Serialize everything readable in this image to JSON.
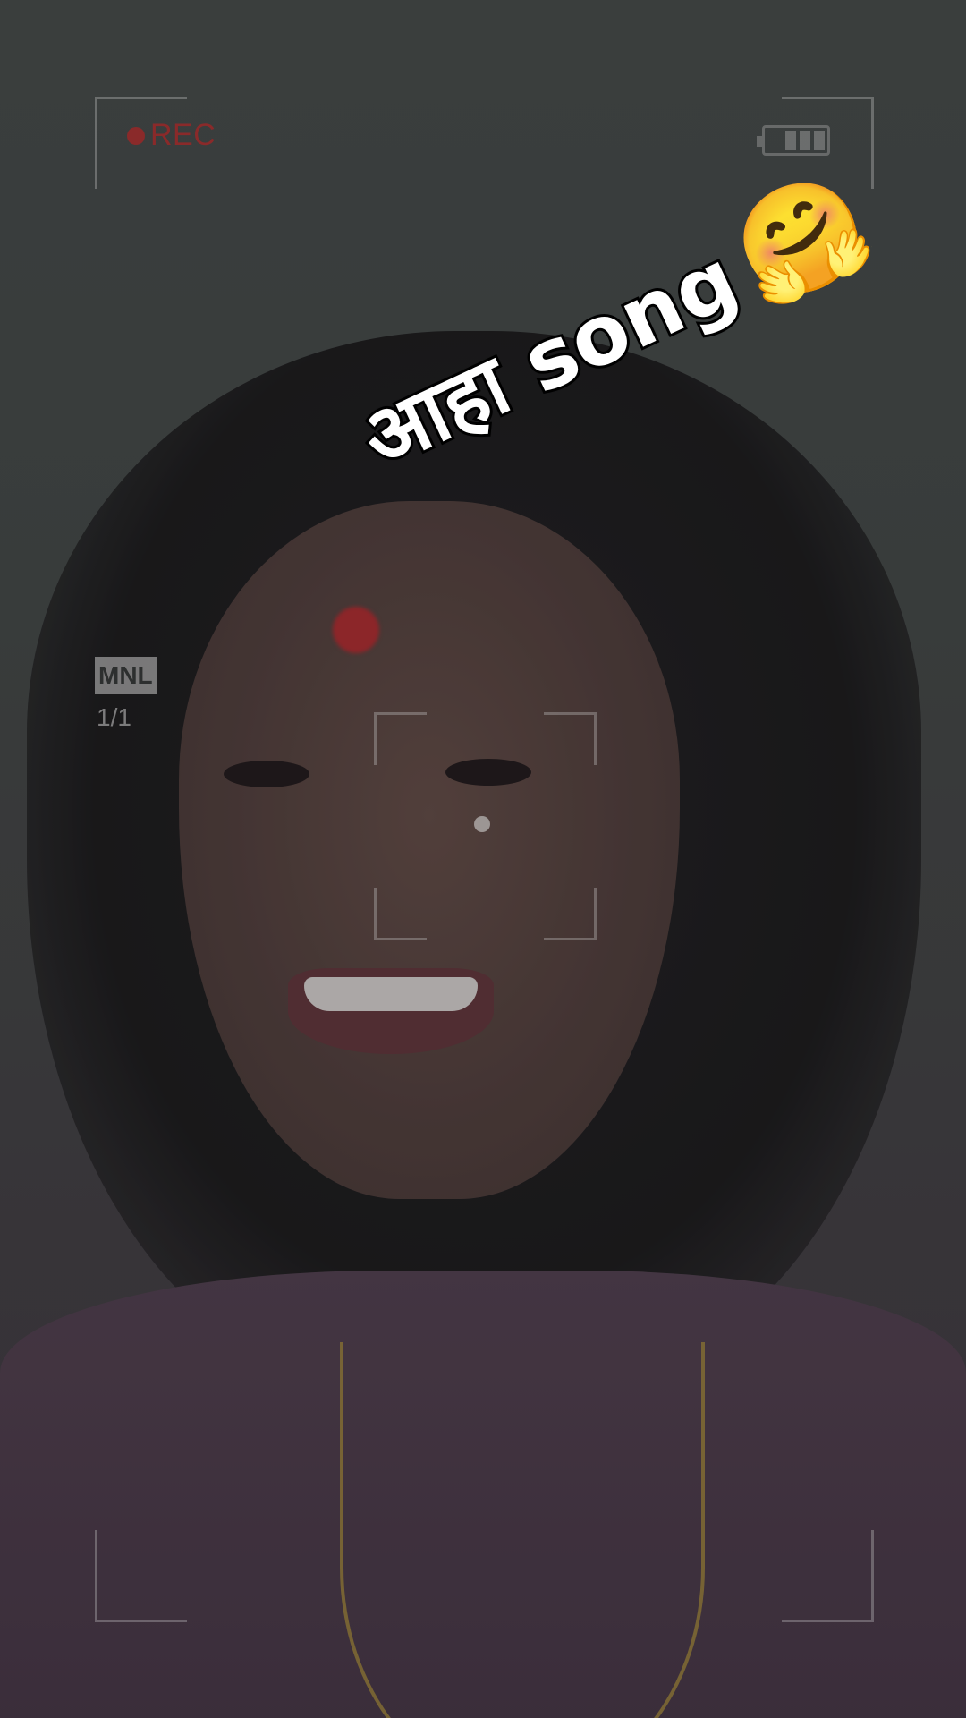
{
  "overlay": {
    "rec_label": "REC",
    "mode_label": "MNL",
    "counter_label": "1/1",
    "battery_level_bars": 3,
    "rec_color": "#8a2a2a"
  },
  "caption": {
    "text": "आहा song",
    "emoji": "🤗",
    "emoji_name": "hugging-face-icon"
  }
}
